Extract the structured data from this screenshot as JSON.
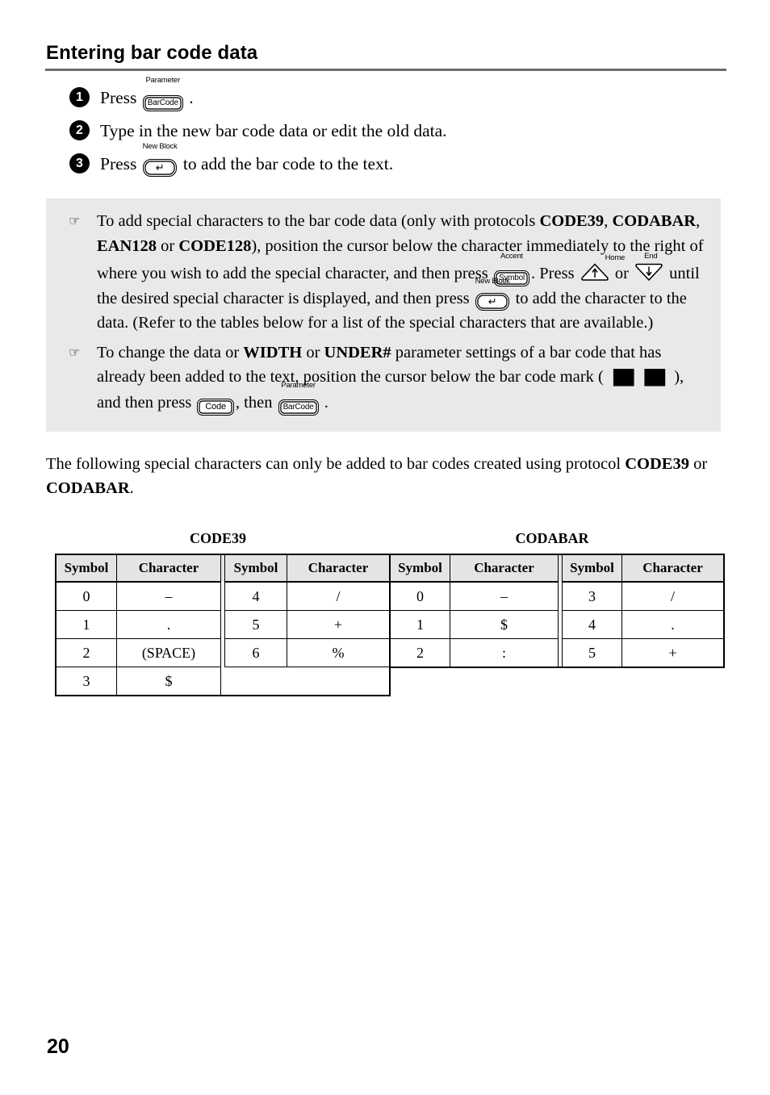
{
  "page": {
    "title": "Entering bar code data",
    "number": "20"
  },
  "steps": [
    {
      "num": "1",
      "pre": "Press",
      "key": {
        "cap": "BarCode",
        "label": "Parameter",
        "type": "keycap"
      },
      "post": "."
    },
    {
      "num": "2",
      "pre": "Type in the new bar code data or edit the old data.",
      "key": null,
      "post": ""
    },
    {
      "num": "3",
      "pre": "Press",
      "key": {
        "cap": "↵",
        "label": "New Block",
        "type": "enter"
      },
      "post": "to add the bar code to the text."
    }
  ],
  "note_box": {
    "bullet_icon": "☞",
    "items": [
      {
        "seg1": "To add special characters to the bar code data (only with protocols ",
        "bold1": "CODE39",
        "seg2": ", ",
        "bold2": "CODABAR",
        "seg3": ", ",
        "bold3": "EAN128",
        "seg4": " or ",
        "bold4": "CODE128",
        "seg5": "), position the cursor below the character immediately to the right of where you wish to add the special character, and then press ",
        "key_symbol": {
          "cap": "Symbol",
          "label": "Accent"
        },
        "seg6": ". Press ",
        "key_up": {
          "cap": "↑",
          "label": "Home"
        },
        "seg7": " or ",
        "key_down": {
          "cap": "↓",
          "label": "End"
        },
        "seg8": " until the desired special character is displayed, and then press ",
        "key_enter": {
          "cap": "↵",
          "label": "New Block"
        },
        "seg9": " to add the character to the data. (Refer to the tables below for a list of the special characters that are available.)"
      },
      {
        "seg1": "To change the data or ",
        "bold1": "WIDTH",
        "seg2": " or ",
        "bold2": "UNDER#",
        "seg3": " parameter settings of a bar code that has already been added to the text, position the cursor below the bar code mark ( ",
        "barcode_mark": "▐█▌▐█▌",
        "seg4": " ), and then press ",
        "key_code": {
          "cap": "Code",
          "label": ""
        },
        "seg5": ", then ",
        "key_barcode": {
          "cap": "BarCode",
          "label": "Parameter"
        },
        "seg6": " ."
      }
    ]
  },
  "intro": {
    "seg1": "The following special characters can only be added to bar codes created using protocol ",
    "bold1": "CODE39",
    "seg2": " or ",
    "bold2": "CODABAR",
    "seg3": "."
  },
  "tables": [
    {
      "id": "code39",
      "title": "CODE39",
      "headers": [
        "Symbol",
        "Character",
        "Symbol",
        "Character"
      ],
      "rows": [
        [
          "0",
          "–",
          "4",
          "/"
        ],
        [
          "1",
          ".",
          "5",
          "+"
        ],
        [
          "2",
          "(SPACE)",
          "6",
          "%"
        ],
        [
          "3",
          "$",
          "",
          ""
        ]
      ]
    },
    {
      "id": "codabar",
      "title": "CODABAR",
      "headers": [
        "Symbol",
        "Character",
        "Symbol",
        "Character"
      ],
      "rows": [
        [
          "0",
          "–",
          "3",
          "/"
        ],
        [
          "1",
          "$",
          "4",
          "."
        ],
        [
          "2",
          ":",
          "5",
          "+"
        ]
      ]
    }
  ]
}
